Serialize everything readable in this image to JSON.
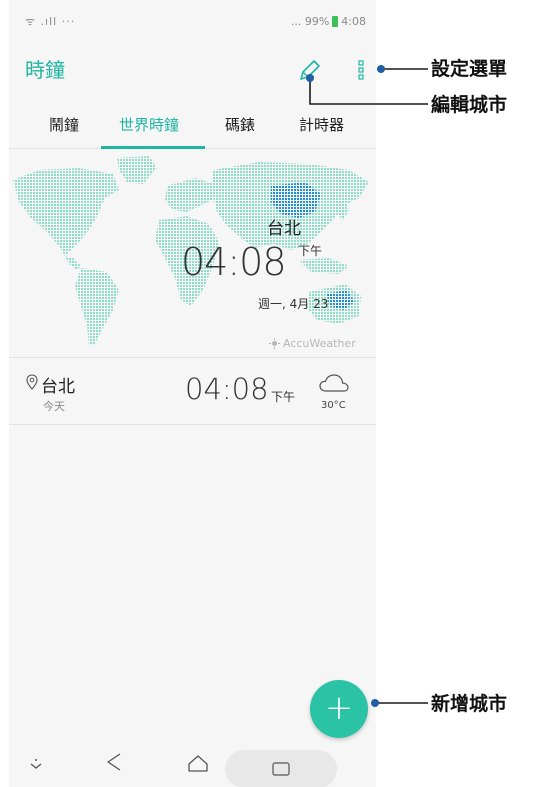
{
  "status_bar": {
    "left_icons": "ᯤ .ıll ···",
    "right_text": "... 99%",
    "time": "4:08"
  },
  "app": {
    "title": "時鐘"
  },
  "icons": {
    "edit": "pencil-icon",
    "more": "more-vertical-icon",
    "pin": "location-pin-icon",
    "weather": "cloud-icon",
    "fab": "plus-icon"
  },
  "tabs": [
    {
      "label": "鬧鐘",
      "active": false
    },
    {
      "label": "世界時鐘",
      "active": true
    },
    {
      "label": "碼錶",
      "active": false
    },
    {
      "label": "計時器",
      "active": false
    }
  ],
  "map": {
    "city": "台北",
    "time": "04:08",
    "ampm": "下午",
    "date": "週一, 4月 23",
    "attribution": "AccuWeather"
  },
  "city_list": [
    {
      "name": "台北",
      "day": "今天",
      "time": "04:08",
      "ampm": "下午",
      "temp": "30°C"
    }
  ],
  "fab": {
    "label": "+"
  },
  "callouts": {
    "settings_menu": "設定選單",
    "edit_city": "編輯城市",
    "add_city": "新增城市"
  },
  "colors": {
    "accent": "#1fb6a4",
    "fab": "#2bc3a6",
    "map_dots": "#8fdcc9",
    "map_dots_highlight": "#1f8fd6"
  }
}
